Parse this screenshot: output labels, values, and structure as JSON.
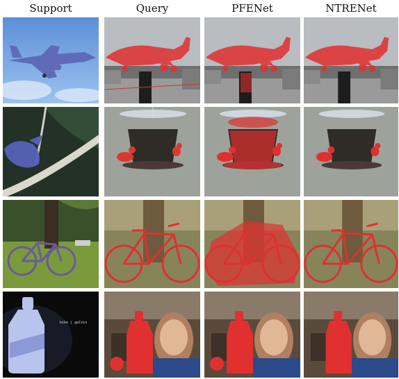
{
  "figure": {
    "columns": [
      {
        "key": "support",
        "label": "Support"
      },
      {
        "key": "query",
        "label": "Query"
      },
      {
        "key": "pfenet",
        "label": "PFENet"
      },
      {
        "key": "ntrenet",
        "label": "NTRENet"
      }
    ],
    "rows": [
      {
        "subject": "airplane"
      },
      {
        "subject": "bird"
      },
      {
        "subject": "bicycle"
      },
      {
        "subject": "bottle"
      }
    ],
    "support_bottle_caption": "bike | galvin",
    "mask_color": "#e03030"
  }
}
